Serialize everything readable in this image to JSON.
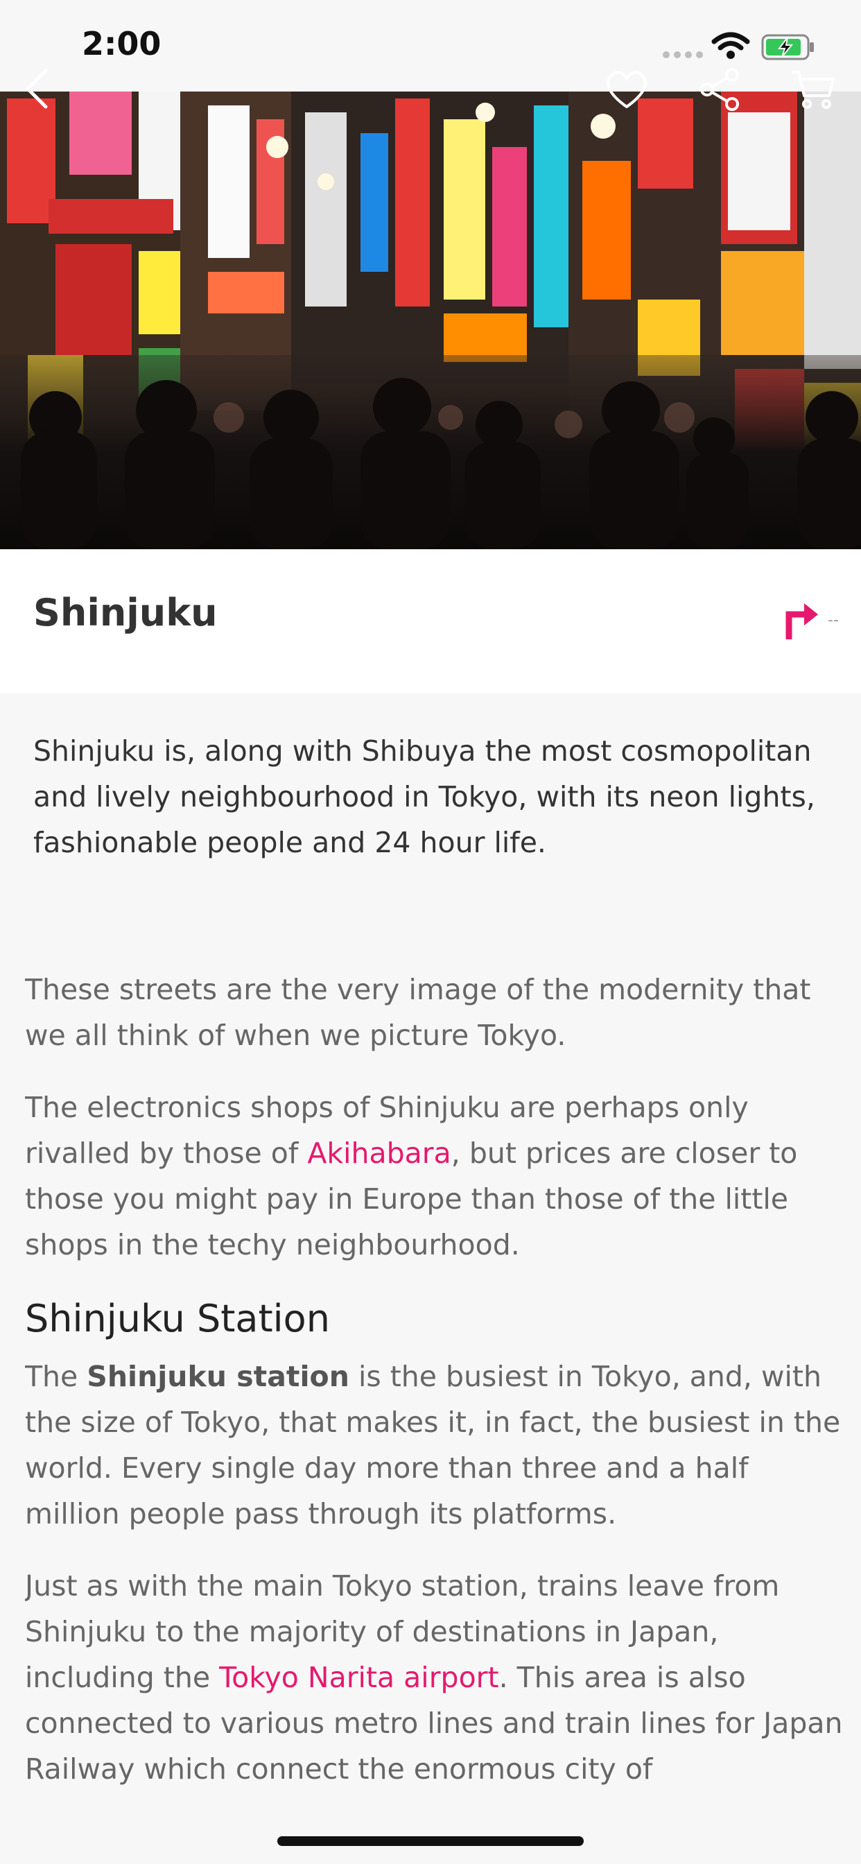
{
  "status_bar": {
    "time": "2:00"
  },
  "place": {
    "title": "Shinjuku",
    "distance": "--"
  },
  "intro": "Shinjuku is, along with Shibuya the most cosmopolitan and lively neighbourhood in Tokyo, with its neon lights, fashionable people and 24 hour life.",
  "article": {
    "p1": "These streets are the very image of the modernity that we all think of when we picture Tokyo.",
    "p2_a": "The electronics shops of Shinjuku are perhaps only rivalled by those of ",
    "p2_link": "Akihabara",
    "p2_b": ", but prices are closer to those you might pay in Europe than those of the little shops in the techy neighbourhood.",
    "heading": "Shinjuku Station",
    "p3_a": "The ",
    "p3_strong": "Shinjuku station",
    "p3_b": " is the busiest in Tokyo, and, with the size of Tokyo, that makes it, in fact, the busiest in the world. Every single day more than three and a half million people pass through its platforms.",
    "p4_a": "Just as with the main Tokyo station, trains leave from Shinjuku to the majority of destinations in Japan, including the ",
    "p4_link": "Tokyo Narita airport",
    "p4_b": ". This area is also connected to various metro lines and train lines for Japan Railway which connect the enormous city of"
  },
  "colors": {
    "accent": "#e6196e",
    "background": "#f7f7f7"
  },
  "icons": [
    "back-icon",
    "heart-icon",
    "share-icon",
    "cart-icon",
    "directions-icon",
    "wifi-icon",
    "battery-icon"
  ]
}
